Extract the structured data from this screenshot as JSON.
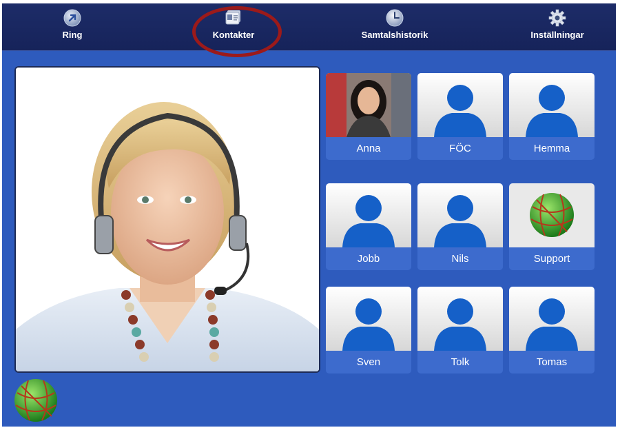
{
  "nav": {
    "items": [
      {
        "label": "Ring",
        "icon": "ring-icon"
      },
      {
        "label": "Kontakter",
        "icon": "contacts-icon"
      },
      {
        "label": "Samtalshistorik",
        "icon": "clock-icon"
      },
      {
        "label": "Inställningar",
        "icon": "gear-icon"
      }
    ],
    "active": "Kontakter"
  },
  "contacts": [
    {
      "name": "Anna",
      "avatar": "photo"
    },
    {
      "name": "FÖC",
      "avatar": "silhouette"
    },
    {
      "name": "Hemma",
      "avatar": "silhouette"
    },
    {
      "name": "Jobb",
      "avatar": "silhouette"
    },
    {
      "name": "Nils",
      "avatar": "silhouette"
    },
    {
      "name": "Support",
      "avatar": "globe"
    },
    {
      "name": "Sven",
      "avatar": "silhouette"
    },
    {
      "name": "Tolk",
      "avatar": "silhouette"
    },
    {
      "name": "Tomas",
      "avatar": "silhouette"
    }
  ],
  "colors": {
    "background": "#2e5bbd",
    "navbar": "#1a2862",
    "highlight": "#9c1a1a",
    "silhouette": "#1560c8"
  }
}
